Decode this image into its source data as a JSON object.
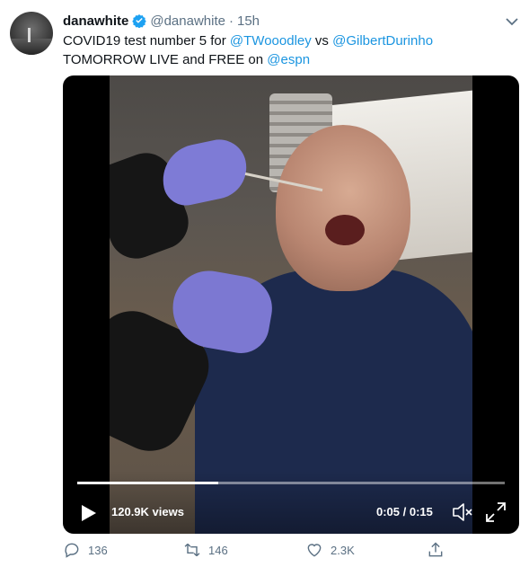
{
  "tweet": {
    "author_name": "danawhite",
    "handle": "@danawhite",
    "dot": "·",
    "time": "15h",
    "text_parts": {
      "p1": "COVID19 test number 5 for ",
      "m1": "@TWooodley",
      "p2": " vs ",
      "m2": "@GilbertDurinho",
      "p3": " TOMORROW LIVE and FREE on ",
      "m3": "@espn"
    }
  },
  "video": {
    "views": "120.9K views",
    "duration": "0:05 / 0:15",
    "progress_fraction": 0.33
  },
  "actions": {
    "reply_count": "136",
    "retweet_count": "146",
    "like_count": "2.3K"
  },
  "colors": {
    "link": "#1b95e0",
    "verified": "#1da1f2",
    "muted": "#5b7083"
  },
  "icons": [
    "verified-badge-icon",
    "caret-down-icon",
    "play-icon",
    "volume-icon",
    "fullscreen-icon",
    "reply-icon",
    "retweet-icon",
    "like-icon",
    "share-icon"
  ]
}
